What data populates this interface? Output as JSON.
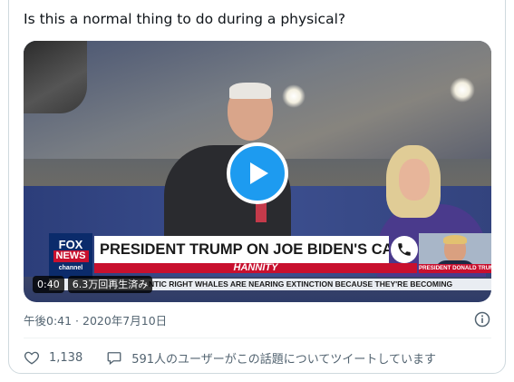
{
  "tweet": {
    "text": "Is this a normal thing to do during a physical?",
    "timestamp": "午後0:41 · 2020年7月10日"
  },
  "video": {
    "duration": "0:40",
    "views": "6.3万回再生済み",
    "chyron": {
      "logo_top": "FOX",
      "logo_bottom": "NEWS",
      "logo_sub": "channel",
      "headline": "PRESIDENT TRUMP ON JOE BIDEN'S CAMPAIGN",
      "show": "HANNITY",
      "ticker": "NTIC RIGHT WHALES ARE NEARING EXTINCTION BECAUSE THEY'RE BECOMING",
      "inset_label": "PRESIDENT DONALD TRUMP"
    }
  },
  "actions": {
    "likes": "1,138",
    "discussion": "591人のユーザーがこの話題についてツイートしています"
  },
  "icons": {
    "play": "play-icon",
    "info": "info-icon",
    "like": "heart-icon",
    "reply": "speech-bubble-icon",
    "phone": "phone-icon"
  },
  "colors": {
    "accent": "#1d9bf0",
    "secondary_text": "#536471",
    "fox_red": "#c8102e",
    "fox_blue": "#0b2b6b"
  }
}
